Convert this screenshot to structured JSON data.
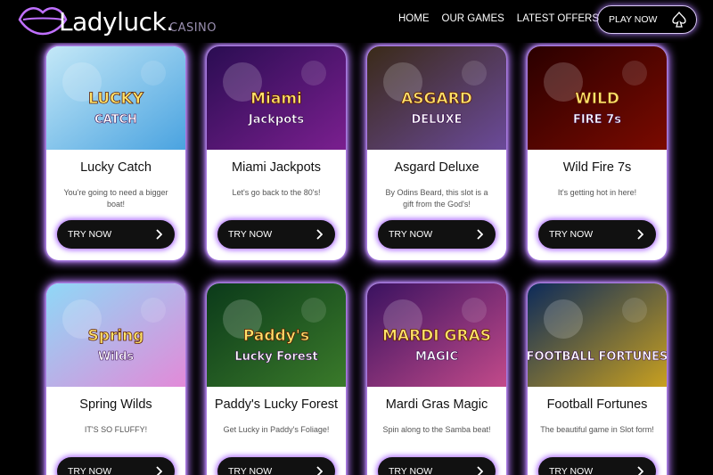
{
  "brand": {
    "name": "Ladyluck.",
    "sub": "CASINO"
  },
  "nav": {
    "items": [
      "HOME",
      "OUR GAMES",
      "LATEST OFFERS"
    ]
  },
  "cta": {
    "play_label": "PLAY NOW"
  },
  "try_label": "TRY NOW",
  "games": [
    {
      "title": "Lucky Catch",
      "desc": "You're going to need a bigger boat!",
      "art": [
        "LUCKY",
        "CATCH"
      ],
      "colors": [
        "#c4e8f7",
        "#4aa3e0"
      ]
    },
    {
      "title": "Miami Jackpots",
      "desc": "Let's go back to the 80's!",
      "art": [
        "Miami",
        "Jackpots"
      ],
      "colors": [
        "#2a0d52",
        "#7a1f8f"
      ]
    },
    {
      "title": "Asgard Deluxe",
      "desc": "By Odins Beard, this slot is a gift from the God's!",
      "art": [
        "ASGARD",
        "DELUXE"
      ],
      "colors": [
        "#3a2a18",
        "#6b4a9a"
      ]
    },
    {
      "title": "Wild Fire 7s",
      "desc": "It's getting hot in here!",
      "art": [
        "WILD",
        "FIRE 7s"
      ],
      "colors": [
        "#2a0000",
        "#7a0a00"
      ]
    },
    {
      "title": "Spring Wilds",
      "desc": "IT'S SO FLUFFY!",
      "art": [
        "Spring",
        "Wilds"
      ],
      "colors": [
        "#8fd8f7",
        "#e28ad8"
      ]
    },
    {
      "title": "Paddy's Lucky Forest",
      "desc": "Get Lucky in Paddy's Foliage!",
      "art": [
        "Paddy's",
        "Lucky Forest"
      ],
      "colors": [
        "#0b3a1a",
        "#3a7a2a"
      ]
    },
    {
      "title": "Mardi Gras Magic",
      "desc": "Spin along to the Samba beat!",
      "art": [
        "MARDI GRAS",
        "MAGIC"
      ],
      "colors": [
        "#3a1260",
        "#c24a8a"
      ]
    },
    {
      "title": "Football Fortunes",
      "desc": "The beautiful game in Slot form!",
      "art": [
        "",
        "FOOTBALL FORTUNES"
      ],
      "colors": [
        "#0c2a5a",
        "#c8a020"
      ]
    }
  ]
}
